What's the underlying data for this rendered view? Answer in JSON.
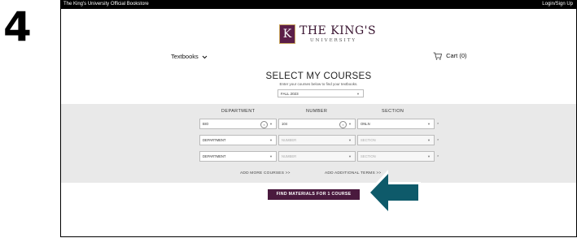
{
  "step_number": "4",
  "topbar": {
    "store_name": "The King's University Official Bookstore",
    "login": "Login/Sign Up"
  },
  "logo": {
    "letter": "K",
    "line1": "THE KING'S",
    "line2": "UNIVERSITY"
  },
  "nav": {
    "textbooks": "Textbooks",
    "cart": "Cart (0)"
  },
  "main": {
    "heading": "SELECT MY COURSES",
    "subheading": "Enter your courses below to find your textbooks.",
    "term": "FALL 2023"
  },
  "columns": {
    "department": "DEPARTMENT",
    "number": "NUMBER",
    "section": "SECTION"
  },
  "rows": [
    {
      "department": "BIO",
      "number": "104",
      "section": "ONLN"
    },
    {
      "department": "DEPARTMENT",
      "number": "NUMBER",
      "section": "SECTION"
    },
    {
      "department": "DEPARTMENT",
      "number": "NUMBER",
      "section": "SECTION"
    }
  ],
  "links": {
    "add_more": "ADD MORE COURSES >>",
    "add_terms": "ADD ADDITIONAL TERMS >>"
  },
  "find_button": "FIND MATERIALS FOR 1 COURSE",
  "colors": {
    "brand": "#4a1a3e",
    "arrow": "#0e5a6a",
    "band": "#e9e9e9"
  }
}
